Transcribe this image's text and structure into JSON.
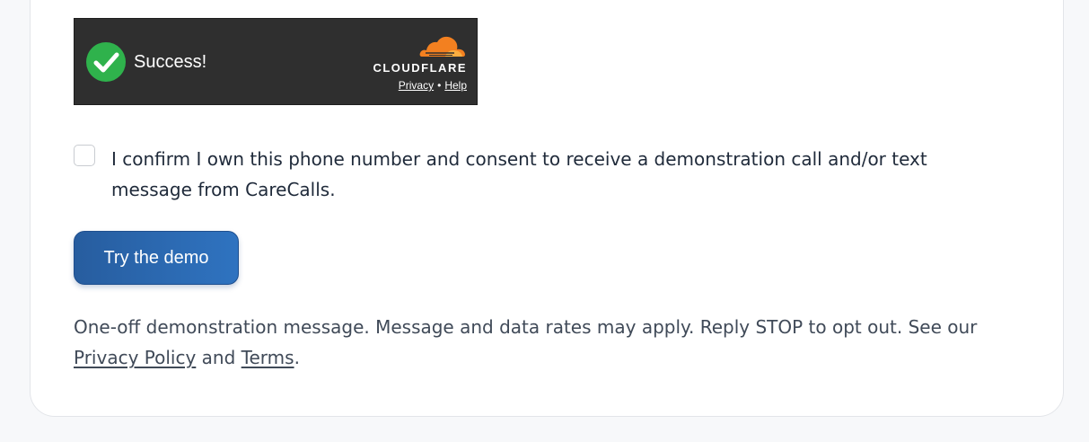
{
  "turnstile": {
    "status": "Success!",
    "brand": "CLOUDFLARE",
    "privacy_link": "Privacy",
    "separator": "•",
    "help_link": "Help",
    "colors": {
      "bg": "#2f2f2f",
      "check": "#2fb24c",
      "cloud": "#f38020"
    }
  },
  "consent": {
    "checked": false,
    "label": "I confirm I own this phone number and consent to receive a demonstration call and/or text message from CareCalls."
  },
  "demo_button": {
    "label": "Try the demo",
    "color": "#2a64ab"
  },
  "disclaimer": {
    "text_before": "One-off demonstration message. Message and data rates may apply. Reply STOP to opt out. See our ",
    "privacy_link": "Privacy Policy",
    "text_middle": " and ",
    "terms_link": "Terms",
    "text_after": "."
  }
}
